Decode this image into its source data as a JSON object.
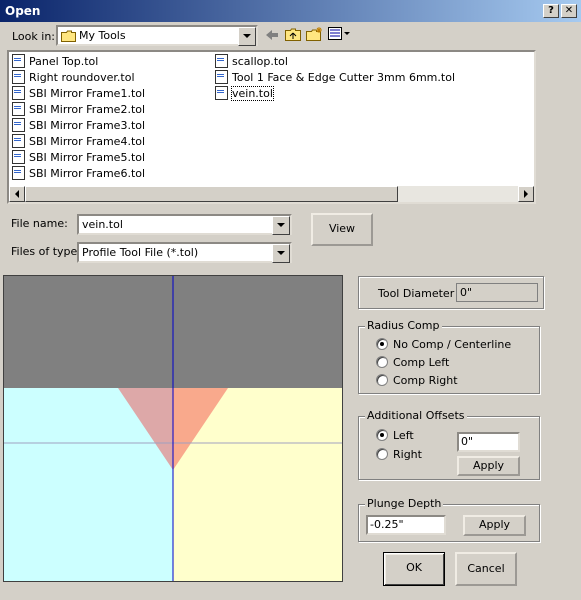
{
  "window": {
    "title": "Open",
    "help_btn": "?",
    "close_btn": "✕"
  },
  "look_in": {
    "label": "Look in:",
    "value": "My Tools"
  },
  "files": [
    "Panel Top.tol",
    "Right roundover.tol",
    "SBI Mirror Frame1.tol",
    "SBI Mirror Frame2.tol",
    "SBI Mirror Frame3.tol",
    "SBI Mirror Frame4.tol",
    "SBI Mirror Frame5.tol",
    "SBI Mirror Frame6.tol",
    "scallop.tol",
    "Tool 1 Face & Edge Cutter 3mm 6mm.tol",
    "vein.tol"
  ],
  "selected_file": "vein.tol",
  "file_name": {
    "label": "File name:",
    "value": "vein.tol"
  },
  "file_type": {
    "label": "Files of type:",
    "value": "Profile Tool File (*.tol)"
  },
  "view_button": "View",
  "tool_diameter": {
    "label": "Tool Diameter",
    "value": "0\""
  },
  "radius_comp": {
    "title": "Radius Comp",
    "options": [
      "No Comp / Centerline",
      "Comp Left",
      "Comp Right"
    ],
    "selected": "No Comp / Centerline"
  },
  "offsets": {
    "title": "Additional Offsets",
    "left": "Left",
    "right": "Right",
    "selected": "Left",
    "value": "0\"",
    "apply": "Apply"
  },
  "plunge": {
    "title": "Plunge Depth",
    "value": "-0.25\"",
    "apply": "Apply"
  },
  "ok_button": "OK",
  "cancel_button": "Cancel",
  "colors": {
    "upper": "#808080",
    "left_fill": "#ccffff",
    "right_fill": "#ffffcc",
    "tool_left": "#dda8a8",
    "tool_right": "#f9a98c",
    "axis": "#0000cc"
  }
}
